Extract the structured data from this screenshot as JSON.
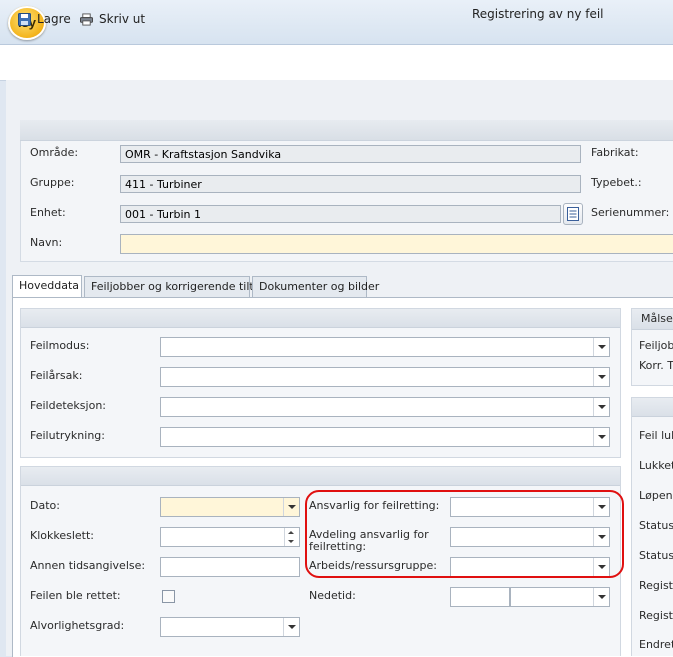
{
  "window": {
    "title": "Registrering av ny feil",
    "logo": "isy"
  },
  "toolbar": {
    "save_label": "Lagre",
    "print_label": "Skriv ut"
  },
  "header": {
    "omrade_label": "Område:",
    "omrade_value": "OMR - Kraftstasjon Sandvika",
    "gruppe_label": "Gruppe:",
    "gruppe_value": "411 - Turbiner",
    "enhet_label": "Enhet:",
    "enhet_value": "001 - Turbin 1",
    "navn_label": "Navn:",
    "navn_value": "",
    "fabrikat_label": "Fabrikat:",
    "typebet_label": "Typebet.:",
    "serienummer_label": "Serienummer:"
  },
  "tabs": [
    {
      "label": "Hoveddata"
    },
    {
      "label": "Feiljobber og korrigerende tiltak"
    },
    {
      "label": "Dokumenter og bilder"
    }
  ],
  "fault_group": {
    "feilmodus_label": "Feilmodus:",
    "feilarsak_label": "Feilårsak:",
    "feildeteksjon_label": "Feildeteksjon:",
    "feilutrykning_label": "Feilutrykning:"
  },
  "time_group": {
    "dato_label": "Dato:",
    "klokkeslett_label": "Klokkeslett:",
    "annen_label": "Annen tidsangivelse:",
    "rettet_label": "Feilen ble rettet:",
    "alvorlighet_label": "Alvorlighetsgrad:",
    "ansvarlig_label": "Ansvarlig for feilretting:",
    "avdeling_label": "Avdeling ansvarlig for feilretting:",
    "arbeid_label": "Arbeids/ressursgruppe:",
    "nedetid_label": "Nedetid:"
  },
  "right_panel": {
    "malset_title": "Målset",
    "feiljobb_label": "Feiljobb",
    "korr_label": "Korr. T",
    "feil_luk_label": "Feil luk",
    "lukket_label": "Lukket",
    "lopenu_label": "Løpenu",
    "status1_label": "Status:",
    "status2_label": "Statuso",
    "registr1_label": "Registr",
    "registr2_label": "Registr",
    "endret_label": "Endret"
  },
  "colors": {
    "highlight": "#e01010",
    "required_field": "#fff6d9",
    "accent": "#f4b51d"
  }
}
